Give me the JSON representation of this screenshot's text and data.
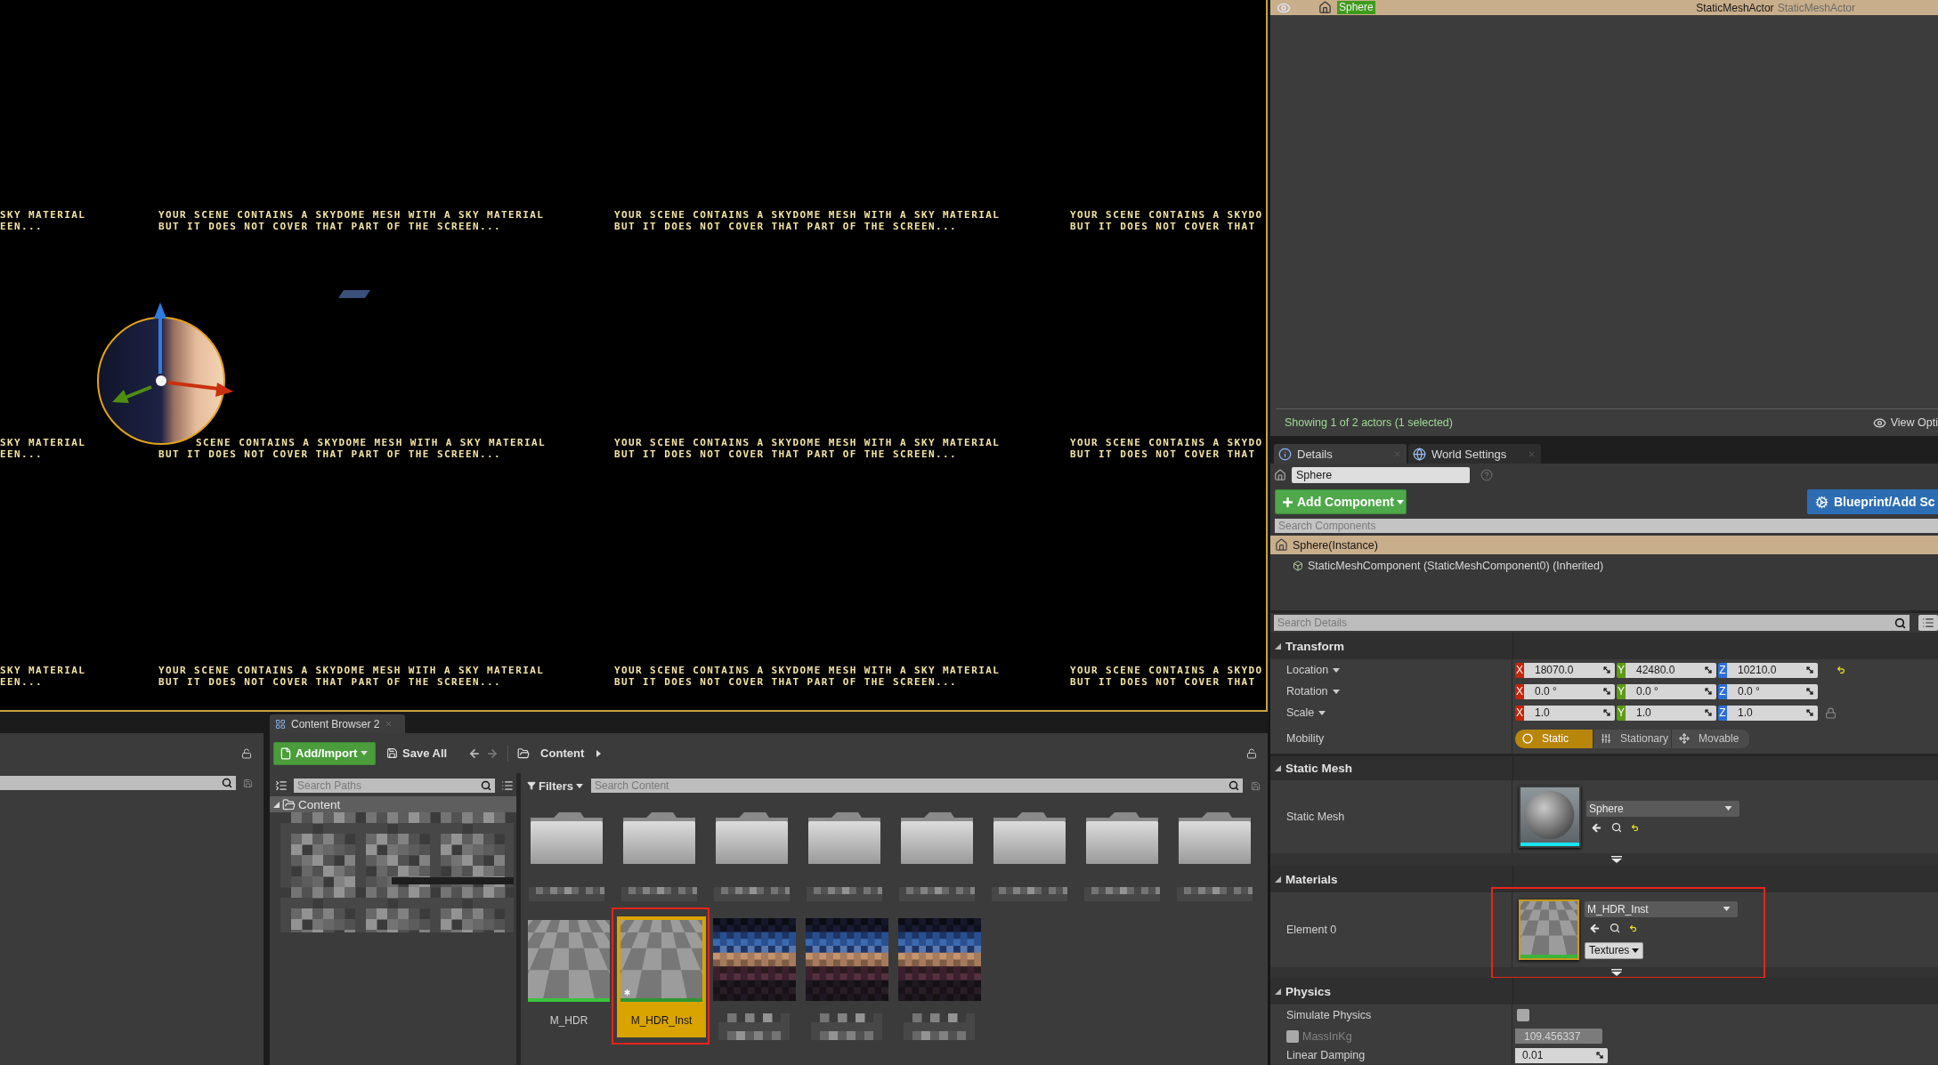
{
  "viewport": {
    "messages": [
      {
        "kind": "plain",
        "lines": [
          "SKY MATERIAL",
          "EEN..."
        ]
      },
      {
        "kind": "plain",
        "lines": [
          "YOUR SCENE CONTAINS A SKYDOME MESH WITH A SKY MATERIAL",
          "BUT IT DOES NOT COVER THAT PART OF THE SCREEN..."
        ]
      },
      {
        "kind": "plain",
        "lines": [
          "YOUR SCENE CONTAINS A SKYDOME MESH WITH A SKY MATERIAL",
          "BUT IT DOES NOT COVER THAT PART OF THE SCREEN..."
        ]
      },
      {
        "kind": "plain",
        "lines": [
          "YOUR SCENE CONTAINS A SKYDO",
          "BUT IT DOES NOT COVER THAT"
        ]
      },
      {
        "kind": "plain",
        "lines": [
          "SKY MATERIAL",
          "EEN..."
        ]
      },
      {
        "kind": "behind_sphere",
        "lines": [
          "SCENE CONTAINS A SKYDOME MESH WITH A SKY MATERIAL",
          "BUT IT DOES NOT COVER THAT PART OF THE SCREEN..."
        ]
      },
      {
        "kind": "plain",
        "lines": [
          "YOUR SCENE CONTAINS A SKYDOME MESH WITH A SKY MATERIAL",
          "BUT IT DOES NOT COVER THAT PART OF THE SCREEN..."
        ]
      },
      {
        "kind": "plain",
        "lines": [
          "YOUR SCENE CONTAINS A SKYDO",
          "BUT IT DOES NOT COVER THAT"
        ]
      },
      {
        "kind": "plain",
        "lines": [
          "SKY MATERIAL",
          "EEN..."
        ]
      },
      {
        "kind": "plain",
        "lines": [
          "YOUR SCENE CONTAINS A SKYDOME MESH WITH A SKY MATERIAL",
          "BUT IT DOES NOT COVER THAT PART OF THE SCREEN..."
        ]
      },
      {
        "kind": "plain",
        "lines": [
          "YOUR SCENE CONTAINS A SKYDOME MESH WITH A SKY MATERIAL",
          "BUT IT DOES NOT COVER THAT PART OF THE SCREEN..."
        ]
      },
      {
        "kind": "plain",
        "lines": [
          "YOUR SCENE CONTAINS A SKYDO",
          "BUT IT DOES NOT COVER THAT"
        ]
      }
    ]
  },
  "content_browser": {
    "tab": {
      "label": "Content Browser 2",
      "selected": true
    },
    "add_import": "Add/Import",
    "save_all": "Save All",
    "path": [
      "Content"
    ],
    "paths_search": {
      "placeholder": "Search Paths"
    },
    "tree": [
      {
        "label": "Content",
        "expanded": true,
        "selected": true
      }
    ],
    "filters": "Filters",
    "content_search": {
      "placeholder": "Search Content"
    },
    "items": [
      {
        "kind": "folder"
      },
      {
        "kind": "folder"
      },
      {
        "kind": "folder"
      },
      {
        "kind": "folder"
      },
      {
        "kind": "folder"
      },
      {
        "kind": "folder"
      },
      {
        "kind": "folder"
      },
      {
        "kind": "folder"
      },
      {
        "kind": "material",
        "label": "M_HDR",
        "selected": false,
        "marked": false
      },
      {
        "kind": "material_instance",
        "label": "M_HDR_Inst",
        "selected": true,
        "marked": true
      },
      {
        "kind": "redacted"
      },
      {
        "kind": "redacted"
      },
      {
        "kind": "redacted"
      }
    ]
  },
  "outliner": {
    "rows": [
      {
        "label": "Sphere",
        "column_2": "StaticMeshActor",
        "column_3": "StaticMeshActor",
        "selected": true,
        "highlighted": true
      }
    ],
    "status": "Showing 1 of 2 actors (1 selected)",
    "view_options": "View Opti"
  },
  "details": {
    "tabs": [
      {
        "label": "Details",
        "selected": true
      },
      {
        "label": "World Settings",
        "selected": false
      }
    ],
    "actor_name": "Sphere",
    "add_component": "Add Component",
    "blueprint_button": "Blueprint/Add Sc",
    "component_search": {
      "placeholder": "Search Components"
    },
    "components": [
      {
        "label": "Sphere(Instance)",
        "selected": true,
        "children": [
          {
            "label": "StaticMeshComponent (StaticMeshComponent0) (Inherited)",
            "selected": false
          }
        ]
      }
    ],
    "details_search": {
      "placeholder": "Search Details"
    },
    "categories": [
      {
        "title": "Transform",
        "expanded": true,
        "advanced": false,
        "rows": [
          {
            "kind": "vector",
            "label": "Location",
            "changed": true,
            "fields": [
              {
                "axis": "X",
                "color": "#c4250b",
                "value": "18070.0"
              },
              {
                "axis": "Y",
                "color": "#5e9a16",
                "value": "42480.0"
              },
              {
                "axis": "Z",
                "color": "#2b6fd6",
                "value": "10210.0"
              }
            ]
          },
          {
            "kind": "vector",
            "label": "Rotation",
            "changed": false,
            "fields": [
              {
                "axis": "X",
                "color": "#c4250b",
                "value": "0.0 °"
              },
              {
                "axis": "Y",
                "color": "#5e9a16",
                "value": "0.0 °"
              },
              {
                "axis": "Z",
                "color": "#2b6fd6",
                "value": "0.0 °"
              }
            ]
          },
          {
            "kind": "scale",
            "label": "Scale",
            "changed": false,
            "fields": [
              {
                "axis": "X",
                "color": "#c4250b",
                "value": "1.0"
              },
              {
                "axis": "Y",
                "color": "#5e9a16",
                "value": "1.0"
              },
              {
                "axis": "Z",
                "color": "#2b6fd6",
                "value": "1.0"
              }
            ]
          },
          {
            "kind": "mobility",
            "label": "Mobility",
            "options": [
              {
                "label": "Static",
                "selected": true
              },
              {
                "label": "Stationary",
                "selected": false
              },
              {
                "label": "Movable",
                "selected": false
              }
            ]
          }
        ]
      },
      {
        "title": "Static Mesh",
        "expanded": true,
        "advanced": true,
        "rows": [
          {
            "kind": "mesh",
            "label": "Static Mesh",
            "value": "Sphere",
            "color": "#19e3f0",
            "highlighted": false,
            "marked": false,
            "changed": true
          }
        ]
      },
      {
        "title": "Materials",
        "expanded": true,
        "advanced": true,
        "rows": [
          {
            "kind": "material",
            "label": "Element 0",
            "value": "M_HDR_Inst",
            "color": "#3cb43c",
            "highlighted": true,
            "marked": true,
            "changed": true,
            "button": "Textures"
          }
        ]
      },
      {
        "title": "Physics",
        "expanded": true,
        "advanced": false,
        "rows": [
          {
            "kind": "checkbox",
            "label": "Simulate Physics",
            "checked": false
          },
          {
            "kind": "override_number",
            "label": "MassInKg",
            "override": false,
            "value": "109.456337"
          },
          {
            "kind": "number",
            "label": "Linear Damping",
            "value": "0.01"
          }
        ]
      }
    ]
  }
}
